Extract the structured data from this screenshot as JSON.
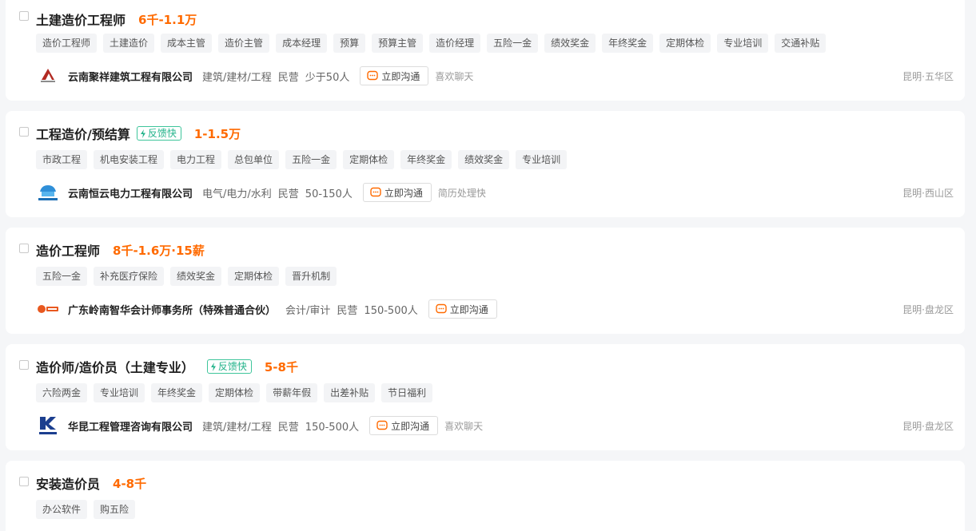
{
  "colors": {
    "salary": "#ff6a00",
    "feedback_badge": "#22b38a",
    "chat_icon": "#ff6a00",
    "card_bg": "#ffffff",
    "page_bg": "#f5f6f8"
  },
  "icons": {
    "checkbox": "checkbox-icon",
    "feedback": "lightning-icon",
    "chat": "chat-bubble-icon"
  },
  "jobs": [
    {
      "title": "土建造价工程师",
      "feedback_badge": "",
      "salary": "6千-1.1万",
      "tags": [
        "造价工程师",
        "土建造价",
        "成本主管",
        "造价主管",
        "成本经理",
        "预算",
        "预算主管",
        "造价经理",
        "五险一金",
        "绩效奖金",
        "年终奖金",
        "定期体检",
        "专业培训",
        "交通补贴"
      ],
      "company": {
        "name": "云南聚祥建筑工程有限公司",
        "industry": "建筑/建材/工程",
        "ownership": "民营",
        "size": "少于50人",
        "logo": "juxiang-logo"
      },
      "chat_label": "立即沟通",
      "activity": "喜欢聊天",
      "location": "昆明·五华区"
    },
    {
      "title": "工程造价/预结算",
      "feedback_badge": "反馈快",
      "salary": "1-1.5万",
      "tags": [
        "市政工程",
        "机电安装工程",
        "电力工程",
        "总包单位",
        "五险一金",
        "定期体检",
        "年终奖金",
        "绩效奖金",
        "专业培训"
      ],
      "company": {
        "name": "云南恒云电力工程有限公司",
        "industry": "电气/电力/水利",
        "ownership": "民营",
        "size": "50-150人",
        "logo": "hengyun-logo"
      },
      "chat_label": "立即沟通",
      "activity": "简历处理快",
      "location": "昆明·西山区"
    },
    {
      "title": "造价工程师",
      "feedback_badge": "",
      "salary": "8千-1.6万·15薪",
      "tags": [
        "五险一金",
        "补充医疗保险",
        "绩效奖金",
        "定期体检",
        "晋升机制"
      ],
      "company": {
        "name": "广东岭南智华会计师事务所（特殊普通合伙）",
        "industry": "会计/审计",
        "ownership": "民营",
        "size": "150-500人",
        "logo": "lingnan-logo"
      },
      "chat_label": "立即沟通",
      "activity": "",
      "location": "昆明·盘龙区"
    },
    {
      "title": "造价师/造价员（土建专业）",
      "feedback_badge": "反馈快",
      "salary": "5-8千",
      "tags": [
        "六险两金",
        "专业培训",
        "年终奖金",
        "定期体检",
        "带薪年假",
        "出差补贴",
        "节日福利"
      ],
      "company": {
        "name": "华昆工程管理咨询有限公司",
        "industry": "建筑/建材/工程",
        "ownership": "民营",
        "size": "150-500人",
        "logo": "hkmc-logo"
      },
      "chat_label": "立即沟通",
      "activity": "喜欢聊天",
      "location": "昆明·盘龙区"
    },
    {
      "title": "安装造价员",
      "feedback_badge": "",
      "salary": "4-8千",
      "tags": [
        "办公软件",
        "购五险"
      ]
    }
  ]
}
